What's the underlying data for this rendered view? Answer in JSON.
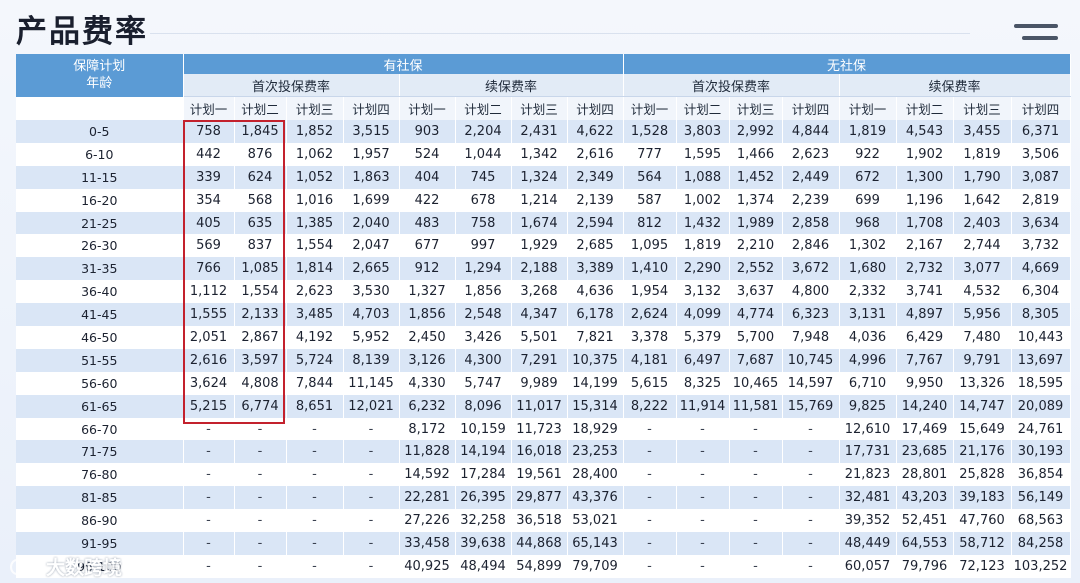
{
  "title": "产品费率",
  "accent_colors": {
    "header": "#5b9bd5",
    "band": "#dae6f6",
    "highlight": "#c3212d"
  },
  "header": {
    "row_label": "保障计划\n年龄",
    "groups": [
      "有社保",
      "无社保"
    ],
    "subgroups": [
      "首次投保费率",
      "续保费率",
      "首次投保费率",
      "续保费率"
    ],
    "plans": [
      "计划一",
      "计划二",
      "计划三",
      "计划四"
    ]
  },
  "rows": [
    {
      "age": "0-5",
      "values": [
        "758",
        "1,845",
        "1,852",
        "3,515",
        "903",
        "2,204",
        "2,431",
        "4,622",
        "1,528",
        "3,803",
        "2,992",
        "4,844",
        "1,819",
        "4,543",
        "3,455",
        "6,371"
      ]
    },
    {
      "age": "6-10",
      "values": [
        "442",
        "876",
        "1,062",
        "1,957",
        "524",
        "1,044",
        "1,342",
        "2,616",
        "777",
        "1,595",
        "1,466",
        "2,623",
        "922",
        "1,902",
        "1,819",
        "3,506"
      ]
    },
    {
      "age": "11-15",
      "values": [
        "339",
        "624",
        "1,052",
        "1,863",
        "404",
        "745",
        "1,324",
        "2,349",
        "564",
        "1,088",
        "1,452",
        "2,449",
        "672",
        "1,300",
        "1,790",
        "3,087"
      ]
    },
    {
      "age": "16-20",
      "values": [
        "354",
        "568",
        "1,016",
        "1,699",
        "422",
        "678",
        "1,214",
        "2,139",
        "587",
        "1,002",
        "1,374",
        "2,239",
        "699",
        "1,196",
        "1,642",
        "2,819"
      ]
    },
    {
      "age": "21-25",
      "values": [
        "405",
        "635",
        "1,385",
        "2,040",
        "483",
        "758",
        "1,674",
        "2,594",
        "812",
        "1,432",
        "1,989",
        "2,858",
        "968",
        "1,708",
        "2,403",
        "3,634"
      ]
    },
    {
      "age": "26-30",
      "values": [
        "569",
        "837",
        "1,554",
        "2,047",
        "677",
        "997",
        "1,929",
        "2,685",
        "1,095",
        "1,819",
        "2,210",
        "2,846",
        "1,302",
        "2,167",
        "2,744",
        "3,732"
      ]
    },
    {
      "age": "31-35",
      "values": [
        "766",
        "1,085",
        "1,814",
        "2,665",
        "912",
        "1,294",
        "2,188",
        "3,389",
        "1,410",
        "2,290",
        "2,552",
        "3,672",
        "1,680",
        "2,732",
        "3,077",
        "4,669"
      ]
    },
    {
      "age": "36-40",
      "values": [
        "1,112",
        "1,554",
        "2,623",
        "3,530",
        "1,327",
        "1,856",
        "3,268",
        "4,636",
        "1,954",
        "3,132",
        "3,637",
        "4,800",
        "2,332",
        "3,741",
        "4,532",
        "6,304"
      ]
    },
    {
      "age": "41-45",
      "values": [
        "1,555",
        "2,133",
        "3,485",
        "4,703",
        "1,856",
        "2,548",
        "4,347",
        "6,178",
        "2,624",
        "4,099",
        "4,774",
        "6,323",
        "3,131",
        "4,897",
        "5,956",
        "8,305"
      ]
    },
    {
      "age": "46-50",
      "values": [
        "2,051",
        "2,867",
        "4,192",
        "5,952",
        "2,450",
        "3,426",
        "5,501",
        "7,821",
        "3,378",
        "5,379",
        "5,700",
        "7,948",
        "4,036",
        "6,429",
        "7,480",
        "10,443"
      ]
    },
    {
      "age": "51-55",
      "values": [
        "2,616",
        "3,597",
        "5,724",
        "8,139",
        "3,126",
        "4,300",
        "7,291",
        "10,375",
        "4,181",
        "6,497",
        "7,687",
        "10,745",
        "4,996",
        "7,767",
        "9,791",
        "13,697"
      ]
    },
    {
      "age": "56-60",
      "values": [
        "3,624",
        "4,808",
        "7,844",
        "11,145",
        "4,330",
        "5,747",
        "9,989",
        "14,199",
        "5,615",
        "8,325",
        "10,465",
        "14,597",
        "6,710",
        "9,950",
        "13,326",
        "18,595"
      ]
    },
    {
      "age": "61-65",
      "values": [
        "5,215",
        "6,774",
        "8,651",
        "12,021",
        "6,232",
        "8,096",
        "11,017",
        "15,314",
        "8,222",
        "11,914",
        "11,581",
        "15,769",
        "9,825",
        "14,240",
        "14,747",
        "20,089"
      ]
    },
    {
      "age": "66-70",
      "values": [
        "-",
        "-",
        "-",
        "-",
        "8,172",
        "10,159",
        "11,723",
        "18,929",
        "-",
        "-",
        "-",
        "-",
        "12,610",
        "17,469",
        "15,649",
        "24,761"
      ]
    },
    {
      "age": "71-75",
      "values": [
        "-",
        "-",
        "-",
        "-",
        "11,828",
        "14,194",
        "16,018",
        "23,253",
        "-",
        "-",
        "-",
        "-",
        "17,731",
        "23,685",
        "21,176",
        "30,193"
      ]
    },
    {
      "age": "76-80",
      "values": [
        "-",
        "-",
        "-",
        "-",
        "14,592",
        "17,284",
        "19,561",
        "28,400",
        "-",
        "-",
        "-",
        "-",
        "21,823",
        "28,801",
        "25,828",
        "36,854"
      ]
    },
    {
      "age": "81-85",
      "values": [
        "-",
        "-",
        "-",
        "-",
        "22,281",
        "26,395",
        "29,877",
        "43,376",
        "-",
        "-",
        "-",
        "-",
        "32,481",
        "43,203",
        "39,183",
        "56,149"
      ]
    },
    {
      "age": "86-90",
      "values": [
        "-",
        "-",
        "-",
        "-",
        "27,226",
        "32,258",
        "36,518",
        "53,021",
        "-",
        "-",
        "-",
        "-",
        "39,352",
        "52,451",
        "47,760",
        "68,563"
      ]
    },
    {
      "age": "91-95",
      "values": [
        "-",
        "-",
        "-",
        "-",
        "33,458",
        "39,638",
        "44,868",
        "65,143",
        "-",
        "-",
        "-",
        "-",
        "48,449",
        "64,553",
        "58,712",
        "84,258"
      ]
    },
    {
      "age": "96-100",
      "values": [
        "-",
        "-",
        "-",
        "-",
        "40,925",
        "48,494",
        "54,899",
        "79,709",
        "-",
        "-",
        "-",
        "-",
        "60,057",
        "79,796",
        "72,123",
        "103,252"
      ]
    }
  ],
  "watermark": "大数跨境"
}
